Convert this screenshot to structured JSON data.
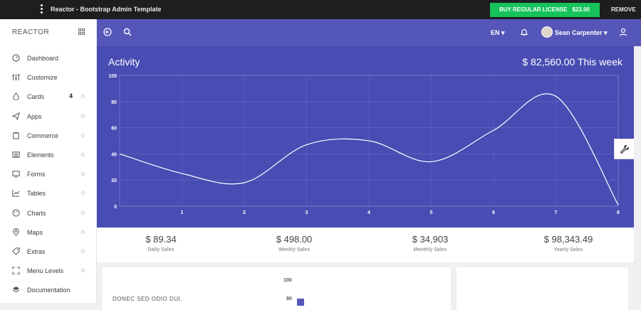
{
  "topbar": {
    "title": "Reactor - Bootstrap Admin Template",
    "buy_label": "BUY REGULAR LICENSE",
    "price": "$23.00",
    "remove_label": "REMOVE"
  },
  "sidebar": {
    "brand": "REACTOR",
    "items": [
      {
        "label": "Dashboard",
        "icon": "gauge-icon"
      },
      {
        "label": "Customize",
        "icon": "sliders-icon"
      },
      {
        "label": "Cards",
        "icon": "drop-icon",
        "badge": "4"
      },
      {
        "label": "Apps",
        "icon": "paper-plane-icon"
      },
      {
        "label": "Commerce",
        "icon": "clipboard-icon"
      },
      {
        "label": "Elements",
        "icon": "list-icon"
      },
      {
        "label": "Forms",
        "icon": "monitor-icon"
      },
      {
        "label": "Tables",
        "icon": "chart-icon"
      },
      {
        "label": "Charts",
        "icon": "palette-icon"
      },
      {
        "label": "Maps",
        "icon": "map-pin-icon"
      },
      {
        "label": "Extras",
        "icon": "tag-icon"
      },
      {
        "label": "Menu Levels",
        "icon": "expand-icon"
      },
      {
        "label": "Documentation",
        "icon": "layers-icon"
      }
    ]
  },
  "header": {
    "language": "EN",
    "user_name": "Sean Carpenter"
  },
  "activity": {
    "title": "Activity",
    "total": "$ 82,560.00 This week"
  },
  "chart_data": {
    "type": "line",
    "title": "",
    "x": [
      0,
      1,
      2,
      3,
      4,
      5,
      6,
      7,
      8
    ],
    "xticks": [
      "1",
      "2",
      "3",
      "4",
      "5",
      "6",
      "7",
      "8"
    ],
    "ylim": [
      0,
      100
    ],
    "yticks": [
      "0",
      "20",
      "40",
      "60",
      "80",
      "100"
    ],
    "series": [
      {
        "values": [
          40,
          25,
          18,
          47,
          50,
          34,
          58,
          84,
          1
        ]
      }
    ],
    "grid": true,
    "line_color": "#ffffff"
  },
  "stats": [
    {
      "value": "$ 89.34",
      "caption": "Daily Sales"
    },
    {
      "value": "$ 498.00",
      "caption": "Weekly Sales"
    },
    {
      "value": "$ 34,903",
      "caption": "Monthly Sales"
    },
    {
      "value": "$ 98,343.49",
      "caption": "Yearly Sales"
    }
  ],
  "lower_card": {
    "label": "DONEC SED ODIO DUI.",
    "tick_top": "100",
    "tick_mid": "80"
  },
  "colors": {
    "accent": "#5457b8",
    "panel": "#484cb3",
    "buy_green": "#16c25a"
  }
}
